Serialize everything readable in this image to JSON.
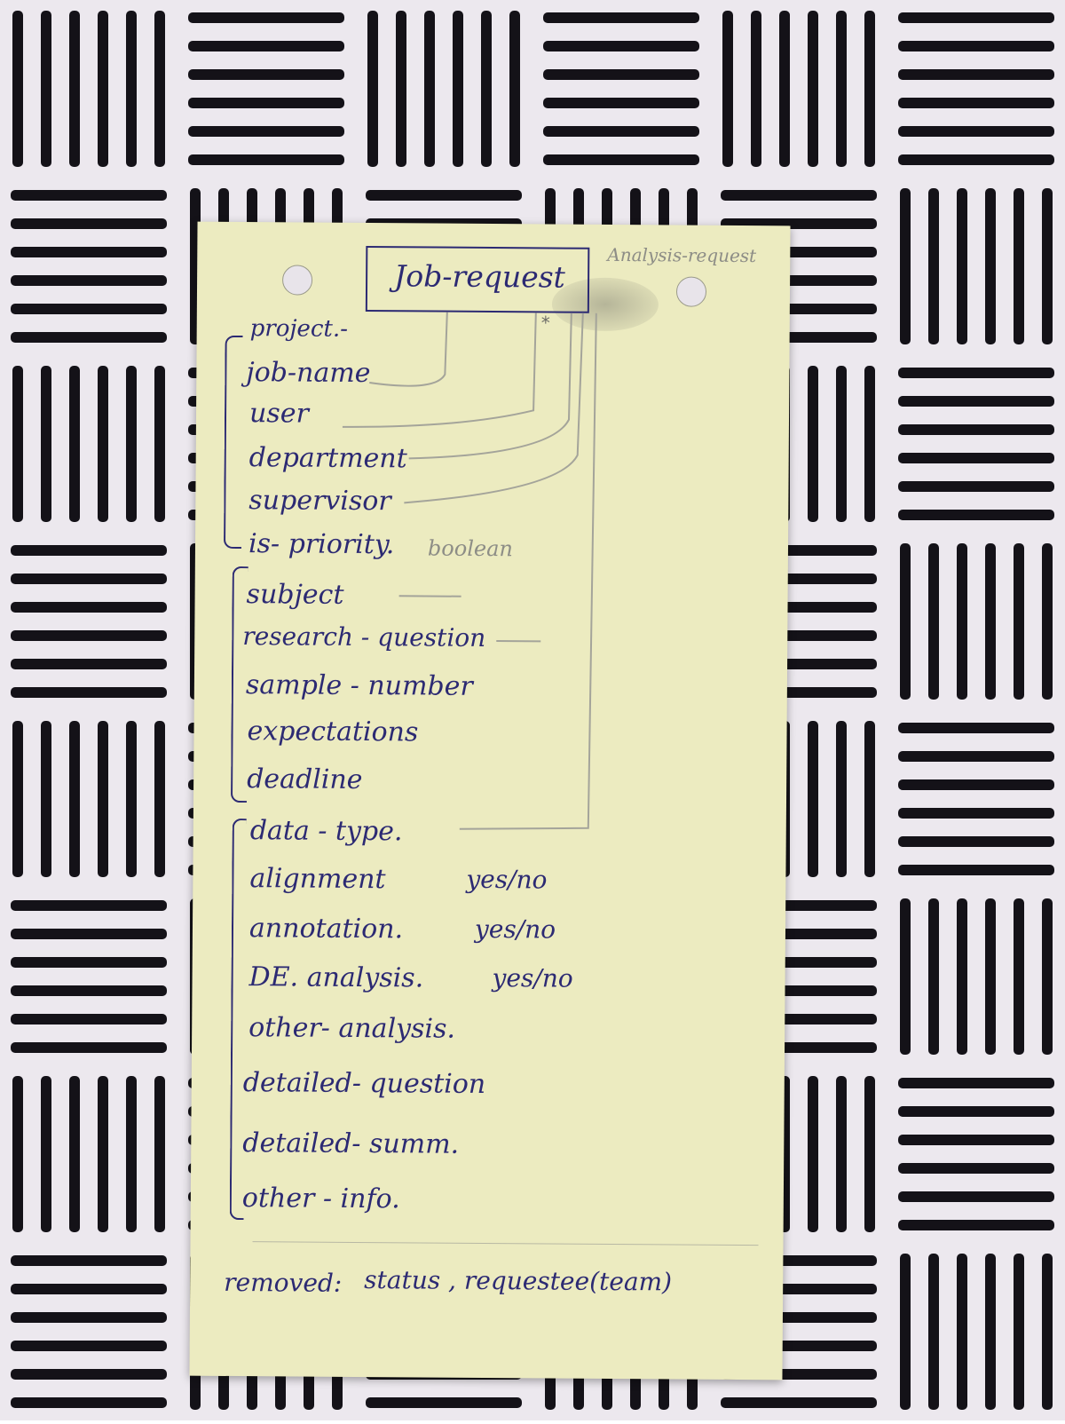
{
  "card": {
    "title": "Job-request",
    "alt_title": "Analysis-request",
    "group1": [
      "project.-",
      "job-name",
      "user",
      "department",
      "supervisor",
      "is- priority.",
      "boolean"
    ],
    "group2": [
      "subject",
      "research - question",
      "sample - number",
      "expectations",
      "deadline"
    ],
    "group3": [
      "data - type.",
      "alignment",
      "annotation.",
      "DE. analysis.",
      "other- analysis.",
      "detailed- question",
      "detailed- summ.",
      "other - info."
    ],
    "yes_no": [
      "yes/no",
      "yes/no",
      "yes/no"
    ],
    "removed_label": "removed:",
    "removed_items": "status , requestee(team)"
  }
}
